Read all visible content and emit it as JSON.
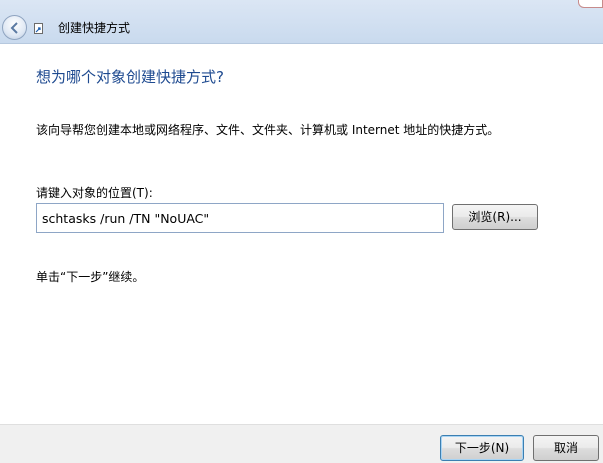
{
  "window": {
    "title": "创建快捷方式",
    "back_icon": "back-arrow-icon",
    "app_icon": "shortcut-icon"
  },
  "wizard": {
    "heading": "想为哪个对象创建快捷方式?",
    "description": "该向导帮您创建本地或网络程序、文件、文件夹、计算机或 Internet 地址的快捷方式。",
    "location_label": "请键入对象的位置(T):",
    "location_value": "schtasks /run /TN \"NoUAC\"",
    "browse_label": "浏览(R)...",
    "hint": "单击“下一步”继续。"
  },
  "footer": {
    "next_label": "下一步(N)",
    "cancel_label": "取消"
  },
  "colors": {
    "heading": "#1e4a90",
    "titlebar": "#d3e1f2",
    "footer": "#f0f0f0"
  }
}
